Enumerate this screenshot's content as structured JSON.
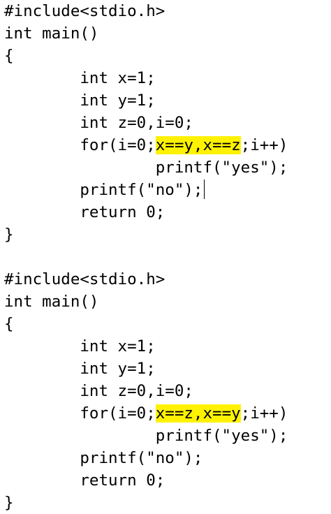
{
  "programs": [
    {
      "lines": [
        [
          "#include<stdio.h>"
        ],
        [
          "int main()"
        ],
        [
          "{"
        ],
        [
          "        int x=1;"
        ],
        [
          "        int y=1;"
        ],
        [
          "        int z=0,i=0;"
        ],
        [
          "        for(i=0;",
          "x==y,x==z",
          ";i++)"
        ],
        [
          "                printf(\"yes\");"
        ],
        [
          "        printf(\"no\");"
        ],
        [
          "        return 0;"
        ],
        [
          "}"
        ]
      ]
    },
    {
      "lines": [
        [
          "#include<stdio.h>"
        ],
        [
          "int main()"
        ],
        [
          "{"
        ],
        [
          "        int x=1;"
        ],
        [
          "        int y=1;"
        ],
        [
          "        int z=0,i=0;"
        ],
        [
          "        for(i=0;",
          "x==z,x==y",
          ";i++)"
        ],
        [
          "                printf(\"yes\");"
        ],
        [
          "        printf(\"no\");"
        ],
        [
          "        return 0;"
        ],
        [
          "}"
        ]
      ]
    }
  ],
  "highlight_color": "#fff200"
}
